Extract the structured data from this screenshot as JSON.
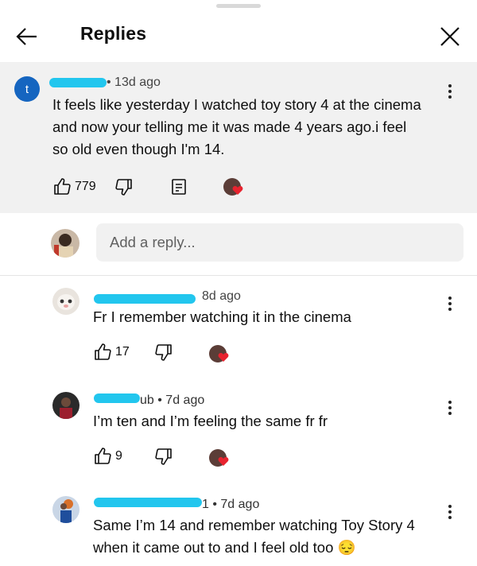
{
  "header": {
    "title": "Replies",
    "back_icon": "arrow-left-icon",
    "close_icon": "close-icon"
  },
  "top_comment": {
    "avatar_letter": "t",
    "time": "• 13d ago",
    "text_lines": [
      "It feels like yesterday I watched toy story 4 at the cinema",
      "and now your telling me it was made 4 years ago.i feel",
      "so old even though I'm 14."
    ],
    "likes": "779"
  },
  "add_reply": {
    "placeholder": "Add a reply..."
  },
  "replies": [
    {
      "time": "8d ago",
      "text": "Fr I remember watching it in the cinema",
      "likes": "17"
    },
    {
      "name_fragment": "ub",
      "time": "• 7d ago",
      "text": "I’m ten and I’m feeling the same fr fr",
      "likes": "9"
    },
    {
      "name_fragment": "1",
      "time": "• 7d ago",
      "text_lines": [
        "Same I’m 14 and remember watching Toy Story 4",
        "when it came out to and I feel old too 😔"
      ]
    }
  ],
  "colors": {
    "accent_blue": "#1565c0",
    "redaction": "#22c6ee",
    "heart": "#e8232f"
  }
}
